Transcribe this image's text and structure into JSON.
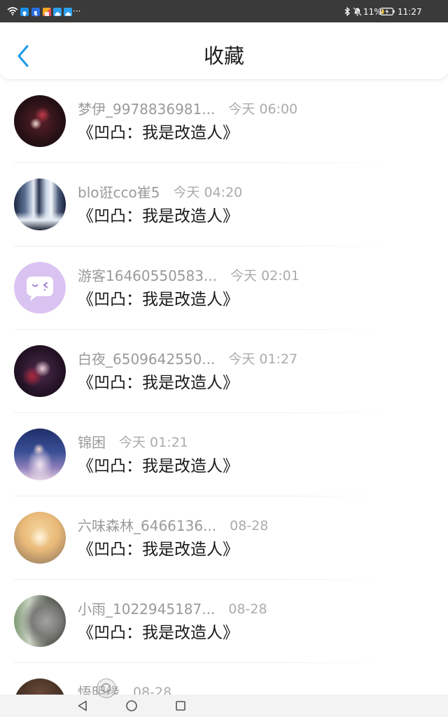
{
  "status_bar": {
    "overflow": "···",
    "battery_percent": "11%",
    "time": "11:27",
    "left_icons": [
      "wifi-icon",
      "map-pin-app-icon",
      "bookmark-app-icon",
      "gallery-app-icon",
      "cloud-app-icon",
      "cloud-app-icon"
    ],
    "right_icons": [
      "bluetooth-icon",
      "mute-bell-icon",
      "battery-charging-icon"
    ]
  },
  "header": {
    "title": "收藏",
    "back_icon": "chevron-left-icon",
    "accent_color": "#1a9ae8"
  },
  "items": [
    {
      "name": "梦伊_9978836981...",
      "time": "今天 06:00",
      "title": "《凹凸：我是改造人》"
    },
    {
      "name": "blo诳cco崔5",
      "time": "今天 04:20",
      "title": "《凹凸：我是改造人》"
    },
    {
      "name": "游客16460550583...",
      "time": "今天 02:01",
      "title": "《凹凸：我是改造人》"
    },
    {
      "name": "白夜_6509642550...",
      "time": "今天 01:27",
      "title": "《凹凸：我是改造人》"
    },
    {
      "name": "锦困",
      "time": "今天 01:21",
      "title": "《凹凸：我是改造人》"
    },
    {
      "name": "六味森林_6466136...",
      "time": "08-28",
      "title": "《凹凸：我是改造人》"
    },
    {
      "name": "小雨_1022945187...",
      "time": "08-28",
      "title": "《凹凸：我是改造人》"
    },
    {
      "name": "悟明缘",
      "time": "08-28"
    }
  ],
  "nav_bar": {
    "icons": [
      "back-triangle-icon",
      "home-circle-icon",
      "recents-square-icon"
    ]
  }
}
